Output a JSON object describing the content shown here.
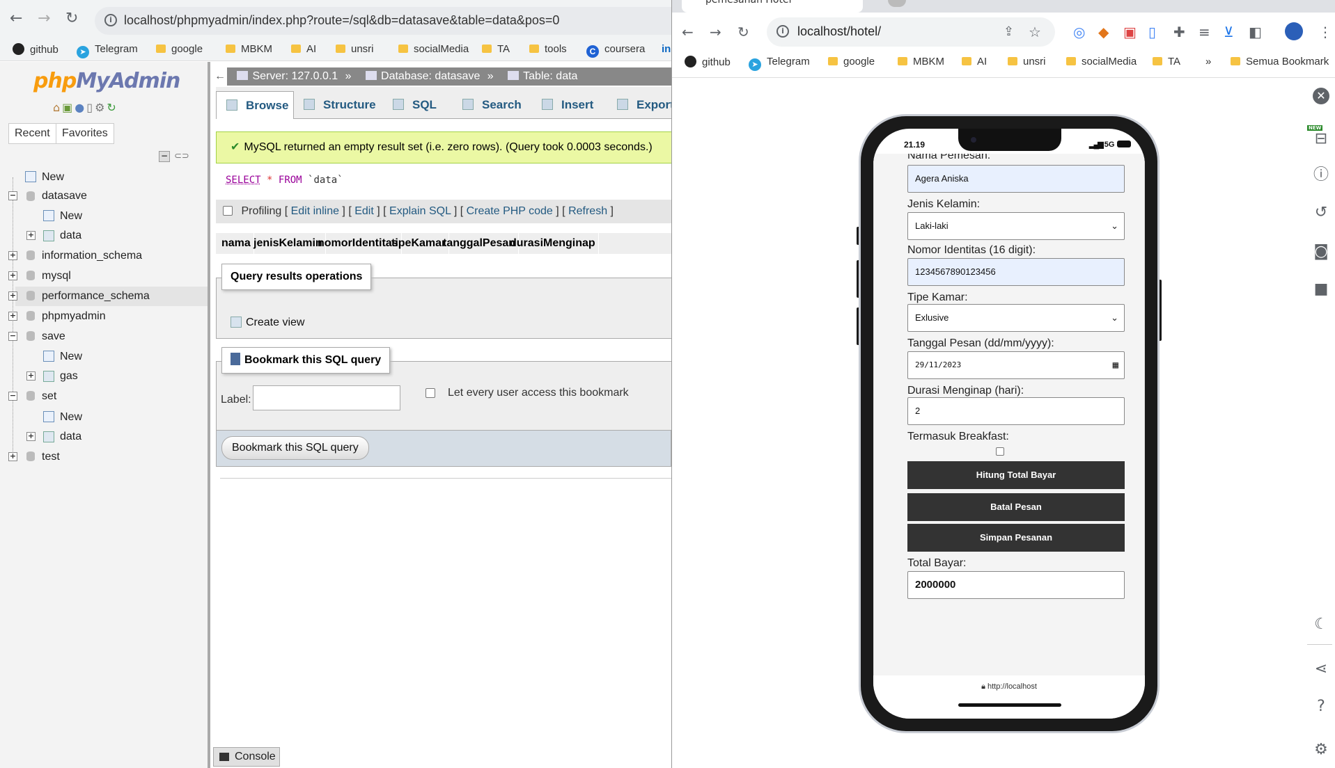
{
  "left": {
    "url": "localhost/phpmyadmin/index.php?route=/sql&db=datasave&table=data&pos=0",
    "bookmarks": [
      "github",
      "Telegram",
      "google",
      "MBKM",
      "AI",
      "unsri",
      "socialMedia",
      "TA",
      "tools",
      "coursera"
    ],
    "pma": {
      "logo_a": "php",
      "logo_b": "MyAdmin",
      "recent": "Recent",
      "favorites": "Favorites",
      "tree": {
        "new_root": "New",
        "datasave": "datasave",
        "datasave_new": "New",
        "datasave_data": "data",
        "information_schema": "information_schema",
        "mysql": "mysql",
        "performance_schema": "performance_schema",
        "phpmyadmin": "phpmyadmin",
        "save": "save",
        "save_new": "New",
        "save_gas": "gas",
        "set": "set",
        "set_new": "New",
        "set_data": "data",
        "test": "test"
      },
      "breadcrumb": {
        "server": "Server: 127.0.0.1",
        "sep": "»",
        "database": "Database: datasave",
        "table": "Table: data"
      },
      "tabs": [
        "Browse",
        "Structure",
        "SQL",
        "Search",
        "Insert",
        "Export"
      ],
      "success": "MySQL returned an empty result set (i.e. zero rows). (Query took 0.0003 seconds.)",
      "sql_kw1": "SELECT",
      "sql_star": "*",
      "sql_kw2": "FROM",
      "sql_table": "`data`",
      "profiling": {
        "label": "Profiling",
        "edit_inline": "Edit inline",
        "edit": "Edit",
        "explain": "Explain SQL",
        "create_php": "Create PHP code",
        "refresh": "Refresh"
      },
      "columns": [
        "nama",
        "jenisKelamin",
        "nomorIdentitas",
        "tipeKamar",
        "tanggalPesan",
        "durasiMenginap"
      ],
      "qro_legend": "Query results operations",
      "create_view": "Create view",
      "bookmark_legend": "Bookmark this SQL query",
      "label": "Label:",
      "every_user": "Let every user access this bookmark",
      "bookmark_btn": "Bookmark this SQL query",
      "console": "Console"
    }
  },
  "right": {
    "tab_title": "pemesanan Hotel",
    "url": "localhost/hotel/",
    "bookmarks": [
      "github",
      "Telegram",
      "google",
      "MBKM",
      "AI",
      "unsri",
      "socialMedia",
      "TA"
    ],
    "more": "»",
    "all_bookmarks": "Semua Bookmark",
    "new_badge": "NEW",
    "phone": {
      "time": "21.19",
      "signal": "5G",
      "label_nama": "Nama Pemesan:",
      "val_nama": "Agera Aniska",
      "label_jk": "Jenis Kelamin:",
      "val_jk": "Laki-laki",
      "label_ni": "Nomor Identitas (16 digit):",
      "val_ni": "1234567890123456",
      "label_tk": "Tipe Kamar:",
      "val_tk": "Exlusive",
      "label_tp": "Tanggal Pesan (dd/mm/yyyy):",
      "val_tp": "29/11/2023",
      "label_dm": "Durasi Menginap (hari):",
      "val_dm": "2",
      "label_bf": "Termasuk Breakfast:",
      "btn_hitung": "Hitung Total Bayar",
      "btn_batal": "Batal Pesan",
      "btn_simpan": "Simpan Pesanan",
      "label_total": "Total Bayar:",
      "val_total": "2000000",
      "footer_url": "http://localhost"
    }
  }
}
